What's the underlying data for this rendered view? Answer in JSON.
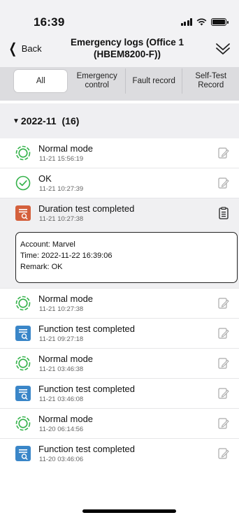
{
  "status_bar": {
    "time": "16:39"
  },
  "nav": {
    "back_label": "Back",
    "title": "Emergency logs (Office 1 (HBEM8200-F))"
  },
  "tabs": [
    {
      "label": "All",
      "active": true
    },
    {
      "label": "Emergency control",
      "active": false
    },
    {
      "label": "Fault record",
      "active": false
    },
    {
      "label": "Self-Test Record",
      "active": false
    }
  ],
  "group": {
    "month": "2022-11",
    "count": "(16)"
  },
  "records": [
    {
      "title": "Normal mode",
      "time": "11-21 15:56:19",
      "icon": "normal-mode-icon"
    },
    {
      "title": "OK",
      "time": "11-21 10:27:39",
      "icon": "ok-check-icon"
    },
    {
      "title": "Duration test completed",
      "time": "11-21 10:27:38",
      "icon": "duration-test-icon"
    },
    {
      "title": "Normal mode",
      "time": "11-21 10:27:38",
      "icon": "normal-mode-icon"
    },
    {
      "title": "Function test completed",
      "time": "11-21 09:27:18",
      "icon": "function-test-icon"
    },
    {
      "title": "Normal mode",
      "time": "11-21 03:46:38",
      "icon": "normal-mode-icon"
    },
    {
      "title": "Function test completed",
      "time": "11-21 03:46:08",
      "icon": "function-test-icon"
    },
    {
      "title": "Normal mode",
      "time": "11-20 06:14:56",
      "icon": "normal-mode-icon"
    },
    {
      "title": "Function test completed",
      "time": "11-20 03:46:06",
      "icon": "function-test-icon"
    }
  ],
  "detail": {
    "account": "Account: Marvel",
    "time": "Time: 2022-11-22 16:39:06",
    "remark": "Remark: OK"
  },
  "colors": {
    "green": "#34b24a",
    "orange": "#d4603c",
    "blue": "#3a86c8"
  }
}
